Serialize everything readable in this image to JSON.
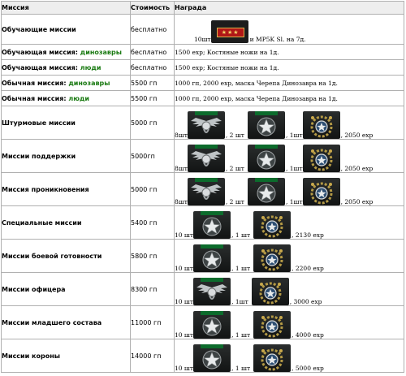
{
  "header": {
    "mission": "Миссия",
    "cost": "Стоимость",
    "reward": "Награда"
  },
  "rows": [
    {
      "mission": "Обучающие миссии",
      "cost": "бесплатно",
      "reward_a": "10шт",
      "reward_b": " и MP5K Sl. на 7д."
    },
    {
      "mission_prefix": "Обучающая миссия: ",
      "mission_green": "динозавры",
      "cost": "бесплатно",
      "reward": "1500 exp; Костяные ножи на 1д."
    },
    {
      "mission_prefix": "Обучающая миссия: ",
      "mission_green": "люди",
      "cost": "бесплатно",
      "reward": "1500 exp; Костяные ножи на 1д."
    },
    {
      "mission_prefix": "Обычная миссия: ",
      "mission_green": "динозавры",
      "cost": "5500 гп",
      "reward": "1000 гп, 2000 exp, маска Черепа Динозавра на 1д."
    },
    {
      "mission_prefix": "Обычная миссия: ",
      "mission_green": "люди",
      "cost": "5500 гп",
      "reward": "1000 гп, 2000 exp, маска Черепа Динозавра на 1д."
    },
    {
      "mission": "Штурмовые миссии",
      "cost": "5000 гп",
      "q1": "8шт",
      "q2": ", 2 шт",
      "q3": ", 1шт",
      "tail": ", 2050 exp"
    },
    {
      "mission": "Миссии поддержки",
      "cost": "5000гп",
      "q1": "8шт",
      "q2": ", 2 шт",
      "q3": ", 1шт",
      "tail": ", 2050 exp"
    },
    {
      "mission": "Миссия проникновения",
      "cost": "5000 гп",
      "q1": "8шт",
      "q2": ", 2 шт",
      "q3": ", 1шт",
      "tail": ", 2050 exp"
    },
    {
      "mission": "Специальные миссии",
      "cost": "5400 гп",
      "q1": "10 шт",
      "q2": ", 1 шт",
      "tail": ", 2130 exp"
    },
    {
      "mission": "Миссии боевой готовности",
      "cost": "5800 гп",
      "q1": "10 шт",
      "q2": ", 1 шт",
      "tail": ", 2200 exp"
    },
    {
      "mission": "Миссии офицера",
      "cost": "8300 гп",
      "q1": "10 шт",
      "q2": ", 1шт",
      "tail": ", 3000 exp"
    },
    {
      "mission": "Миссии младшего состава",
      "cost": "11000 гп",
      "q1": "10 шт",
      "q2": ", 1 шт",
      "tail": ", 4000 exp"
    },
    {
      "mission": "Миссии короны",
      "cost": "14000 гп",
      "q1": "10 шт",
      "q2": ", 1 шт",
      "tail": ", 5000 exp"
    }
  ],
  "icons": {
    "rank_stars": "rank-stars-icon",
    "wings": "wings-medal-icon",
    "star": "star-medal-icon",
    "wreath": "wreath-medal-icon",
    "crown": "crown-medal-icon"
  },
  "colors": {
    "green_text": "#1a7a12",
    "badge_stripe": "#0c6b2c",
    "rank_plate": "#b01717"
  }
}
